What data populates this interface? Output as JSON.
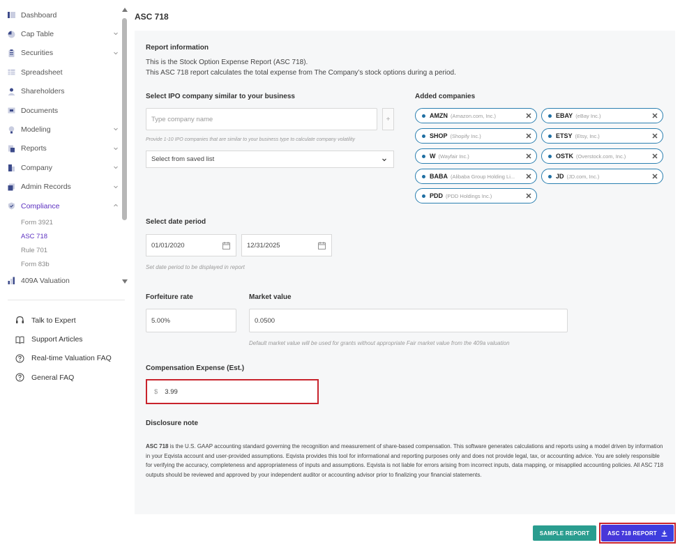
{
  "sidebar": {
    "items": [
      {
        "label": "Dashboard",
        "icon": "dashboard-icon",
        "chevron": false
      },
      {
        "label": "Cap Table",
        "icon": "pie-chart-icon",
        "chevron": true
      },
      {
        "label": "Securities",
        "icon": "clipboard-icon",
        "chevron": true
      },
      {
        "label": "Spreadsheet",
        "icon": "spreadsheet-icon",
        "chevron": false
      },
      {
        "label": "Shareholders",
        "icon": "user-icon",
        "chevron": false
      },
      {
        "label": "Documents",
        "icon": "documents-icon",
        "chevron": false
      },
      {
        "label": "Modeling",
        "icon": "lightbulb-icon",
        "chevron": true
      },
      {
        "label": "Reports",
        "icon": "reports-icon",
        "chevron": true
      },
      {
        "label": "Company",
        "icon": "building-icon",
        "chevron": true
      },
      {
        "label": "Admin Records",
        "icon": "records-icon",
        "chevron": true
      },
      {
        "label": "Compliance",
        "icon": "shield-check-icon",
        "chevron": true
      }
    ],
    "compliance_sub": [
      "Form 3921",
      "ASC 718",
      "Rule 701",
      "Form 83b"
    ],
    "valuation_label": "409A Valuation",
    "help": [
      "Talk to Expert",
      "Support Articles",
      "Real-time Valuation FAQ",
      "General FAQ"
    ]
  },
  "main": {
    "title": "ASC 718",
    "report_info_label": "Report information",
    "report_info_line1": "This is the Stock Option Expense Report (ASC 718).",
    "report_info_line2": "This ASC 718 report calculates the total expense from The Company’s stock options during a period.",
    "ipo_label": "Select IPO company similar to your business",
    "company_placeholder": "Type company name",
    "plus_label": "+",
    "ipo_hint": "Provide 1-10 IPO companies that are similar to your business type to calculate company volatility",
    "saved_list": "Select from saved list",
    "added_label": "Added companies",
    "companies": [
      {
        "ticker": "AMZN",
        "name": "(Amazon.com, Inc.)"
      },
      {
        "ticker": "EBAY",
        "name": "(eBay Inc.)"
      },
      {
        "ticker": "SHOP",
        "name": "(Shopify Inc.)"
      },
      {
        "ticker": "ETSY",
        "name": "(Etsy, Inc.)"
      },
      {
        "ticker": "W",
        "name": "(Wayfair Inc.)"
      },
      {
        "ticker": "OSTK",
        "name": "(Overstock.com, Inc.)"
      },
      {
        "ticker": "BABA",
        "name": "(Alibaba Group Holding Li..."
      },
      {
        "ticker": "JD",
        "name": "(JD.com, Inc.)"
      },
      {
        "ticker": "PDD",
        "name": "(PDD Holdings Inc.)"
      }
    ],
    "date_label": "Select date period",
    "date_start": "01/01/2020",
    "date_end": "12/31/2025",
    "date_hint": "Set date period to be displayed in report",
    "forfeiture_label": "Forfeiture rate",
    "forfeiture_value": "5.00%",
    "market_label": "Market value",
    "market_value": "0.0500",
    "market_hint": "Default market value will be used for grants without appropriate Fair market value from the 409a valuation",
    "comp_label": "Compensation Expense (Est.)",
    "comp_currency": "$",
    "comp_value": "3.99",
    "disclosure_label": "Disclosure note",
    "disclosure_bold": "ASC 718",
    "disclosure_text": " is the U.S. GAAP accounting standard governing the recognition and measurement of share-based compensation. This software generates calculations and reports using a model driven by information in your Eqvista account and user-provided assumptions. Eqvista provides this tool for informational and reporting purposes only and does not provide legal, tax, or accounting advice. You are solely responsible for verifying the accuracy, completeness and appropriateness of inputs and assumptions. Eqvista is not liable for errors arising from incorrect inputs, data mapping, or misapplied accounting policies. All ASC 718 outputs should be reviewed and approved by your independent auditor or accounting advisor prior to finalizing your financial statements.",
    "sample_button": "SAMPLE REPORT",
    "report_button": "ASC 718 REPORT"
  },
  "colors": {
    "accent": "#5b2fc0",
    "chip_border": "#2a7fb0",
    "sample_btn": "#2a9d8f",
    "report_btn": "#4a36d8",
    "highlight": "#c8232c"
  }
}
